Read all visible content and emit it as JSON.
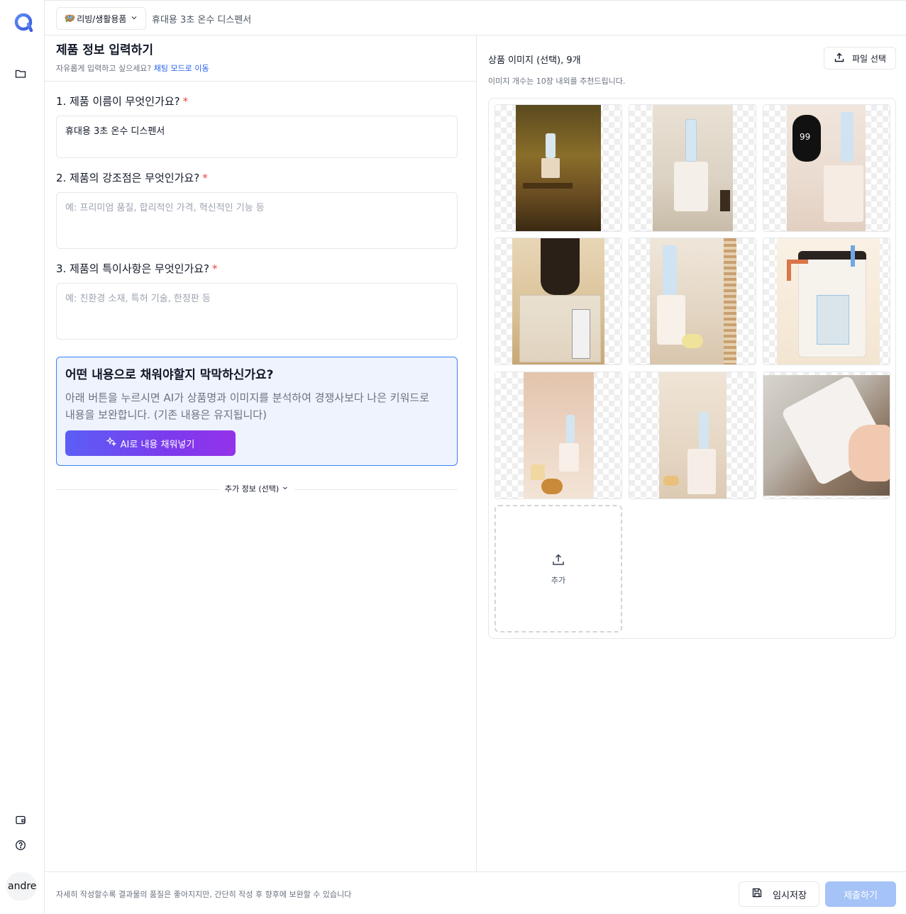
{
  "topbar": {
    "category_emoji": "🪺",
    "category_label": "리빙/생활용품",
    "breadcrumb": "휴대용 3초 온수 디스펜서"
  },
  "sidebar": {
    "user_name": "andrew"
  },
  "form": {
    "title": "제품 정보 입력하기",
    "subtitle_text": "자유롭게 입력하고 싶으세요?",
    "subtitle_link": "채팅 모드로 이동",
    "required_mark": "*",
    "questions": [
      {
        "label": "1. 제품 이름이 무엇인가요?",
        "value": "휴대용 3초 온수 디스펜서",
        "placeholder": ""
      },
      {
        "label": "2. 제품의 강조점은 무엇인가요?",
        "value": "",
        "placeholder": "예: 프리미엄 품질, 합리적인 가격, 혁신적인 기능 등"
      },
      {
        "label": "3. 제품의 특이사항은 무엇인가요?",
        "value": "",
        "placeholder": "예: 친환경 소재, 특허 기술, 한정판 등"
      }
    ],
    "ai_box": {
      "title": "어떤 내용으로 채워야할지 막막하신가요?",
      "description": "아래 버튼을 누르시면 AI가 상품명과 이미지를 분석하여 경쟁사보다 나은 키워드로 내용을 보완합니다. (기존 내용은 유지됩니다)",
      "button_label": "AI로 내용 채워넣기"
    },
    "extra_info_label": "추가 정보 (선택)"
  },
  "images": {
    "title": "상품 이미지 (선택), 9개",
    "hint": "이미지 개수는 10장 내외를 추천드립니다.",
    "file_button_label": "파일 선택",
    "add_label": "추가"
  },
  "footer": {
    "tip": "자세히 작성할수록 결과물의 품질은 좋아지지만, 간단히 작성 후 향후에 보완할 수 있습니다",
    "save_label": "임시저장",
    "submit_label": "제출하기"
  },
  "colors": {
    "accent": "#2563eb",
    "required": "#ef4444",
    "ai_gradient_start": "#5b5ff5",
    "ai_gradient_end": "#9333ea",
    "submit_disabled": "#a5c3f7"
  }
}
